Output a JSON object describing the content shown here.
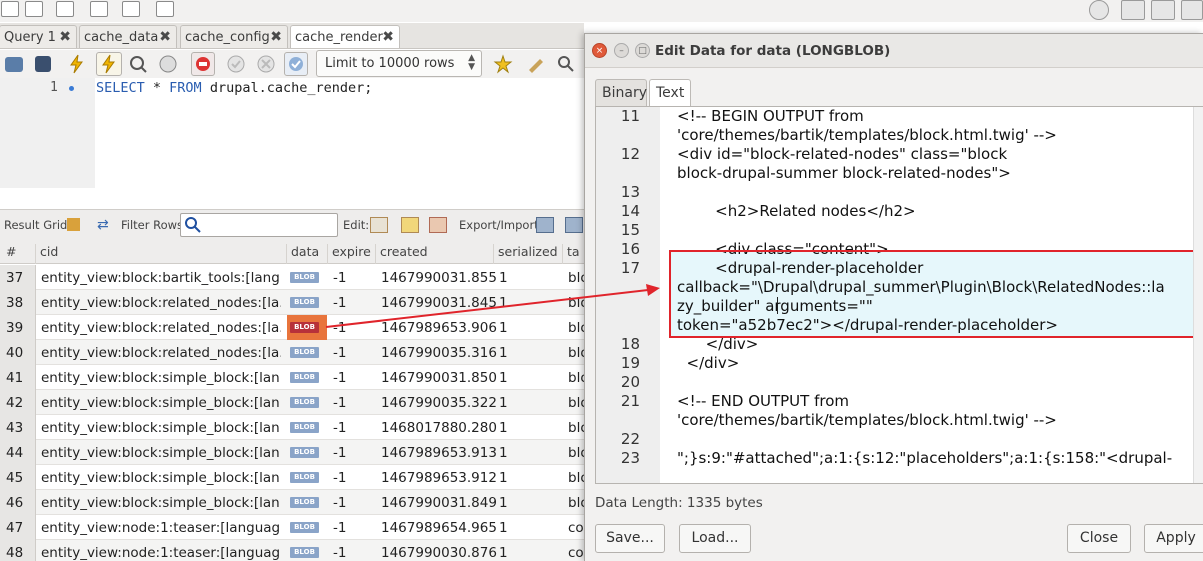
{
  "tabs": [
    {
      "label": "Query 1",
      "active": false
    },
    {
      "label": "cache_data",
      "active": false
    },
    {
      "label": "cache_config",
      "active": false
    },
    {
      "label": "cache_render",
      "active": true
    }
  ],
  "toolbar": {
    "limit_label": "Limit to 10000 rows"
  },
  "editor": {
    "line_number": "1",
    "sql_keyword_select": "SELECT",
    "sql_star": " * ",
    "sql_keyword_from": "FROM",
    "sql_rest": " drupal.cache_render;"
  },
  "result_toolbar": {
    "result_grid": "Result Grid",
    "filter_rows": "Filter Rows:",
    "edit": "Edit:",
    "export_import": "Export/Import:"
  },
  "grid": {
    "columns": [
      "#",
      "cid",
      "data",
      "expire",
      "created",
      "serialized",
      "ta"
    ],
    "blob_label": "BLOB",
    "rows": [
      {
        "num": "37",
        "cid": "entity_view:block:bartik_tools:[lang...",
        "expire": "-1",
        "created": "1467990031.855",
        "serialized": "1",
        "tags": "blo"
      },
      {
        "num": "38",
        "cid": "entity_view:block:related_nodes:[la...",
        "expire": "-1",
        "created": "1467990031.845",
        "serialized": "1",
        "tags": "blo"
      },
      {
        "num": "39",
        "cid": "entity_view:block:related_nodes:[la...",
        "expire": "-1",
        "created": "1467989653.906",
        "serialized": "1",
        "tags": "blo"
      },
      {
        "num": "40",
        "cid": "entity_view:block:related_nodes:[la...",
        "expire": "-1",
        "created": "1467990035.316",
        "serialized": "1",
        "tags": "blo"
      },
      {
        "num": "41",
        "cid": "entity_view:block:simple_block:[lan...",
        "expire": "-1",
        "created": "1467990031.850",
        "serialized": "1",
        "tags": "blo"
      },
      {
        "num": "42",
        "cid": "entity_view:block:simple_block:[lan...",
        "expire": "-1",
        "created": "1467990035.322",
        "serialized": "1",
        "tags": "blo"
      },
      {
        "num": "43",
        "cid": "entity_view:block:simple_block:[lan...",
        "expire": "-1",
        "created": "1468017880.280",
        "serialized": "1",
        "tags": "blo"
      },
      {
        "num": "44",
        "cid": "entity_view:block:simple_block:[lan...",
        "expire": "-1",
        "created": "1467989653.913",
        "serialized": "1",
        "tags": "blo"
      },
      {
        "num": "45",
        "cid": "entity_view:block:simple_block:[lan...",
        "expire": "-1",
        "created": "1467989653.912",
        "serialized": "1",
        "tags": "blo"
      },
      {
        "num": "46",
        "cid": "entity_view:block:simple_block:[lan...",
        "expire": "-1",
        "created": "1467990031.849",
        "serialized": "1",
        "tags": "blo"
      },
      {
        "num": "47",
        "cid": "entity_view:node:1:teaser:[languag...",
        "expire": "-1",
        "created": "1467989654.965",
        "serialized": "1",
        "tags": "co"
      },
      {
        "num": "48",
        "cid": "entity_view:node:1:teaser:[languag...",
        "expire": "-1",
        "created": "1467990030.876",
        "serialized": "1",
        "tags": "co"
      }
    ]
  },
  "dialog": {
    "title": "Edit Data for data (LONGBLOB)",
    "tab_binary": "Binary",
    "tab_text": "Text",
    "lines": [
      {
        "n": "11",
        "texts": [
          "<!-- BEGIN OUTPUT from",
          "'core/themes/bartik/templates/block.html.twig' -->"
        ]
      },
      {
        "n": "12",
        "texts": [
          "<div id=\"block-related-nodes\" class=\"block",
          "block-drupal-summer block-related-nodes\">"
        ]
      },
      {
        "n": "13",
        "texts": [
          ""
        ]
      },
      {
        "n": "14",
        "texts": [
          "        <h2>Related nodes</h2>"
        ]
      },
      {
        "n": "15",
        "texts": [
          ""
        ]
      },
      {
        "n": "16",
        "texts": [
          "        <div class=\"content\">"
        ]
      },
      {
        "n": "17",
        "texts": [
          "        <drupal-render-placeholder",
          "callback=\"\\Drupal\\drupal_summer\\Plugin\\Block\\RelatedNodes::la",
          "zy_builder\" arguments=\"\"",
          "token=\"a52b7ec2\"></drupal-render-placeholder>"
        ]
      },
      {
        "n": "18",
        "texts": [
          "      </div>"
        ]
      },
      {
        "n": "19",
        "texts": [
          "  </div>"
        ]
      },
      {
        "n": "20",
        "texts": [
          ""
        ]
      },
      {
        "n": "21",
        "texts": [
          "<!-- END OUTPUT from",
          "'core/themes/bartik/templates/block.html.twig' -->"
        ]
      },
      {
        "n": "22",
        "texts": [
          ""
        ]
      },
      {
        "n": "23",
        "texts": [
          "\";}s:9:\"#attached\";a:1:{s:12:\"placeholders\";a:1:{s:158:\"<drupal-"
        ]
      }
    ],
    "data_length": "Data Length: 1335 bytes",
    "buttons": {
      "save": "Save...",
      "load": "Load...",
      "close": "Close",
      "apply": "Apply"
    }
  },
  "colors": {
    "highlight_border": "#e0242b",
    "blob_selected_bg": "#e8743c"
  }
}
